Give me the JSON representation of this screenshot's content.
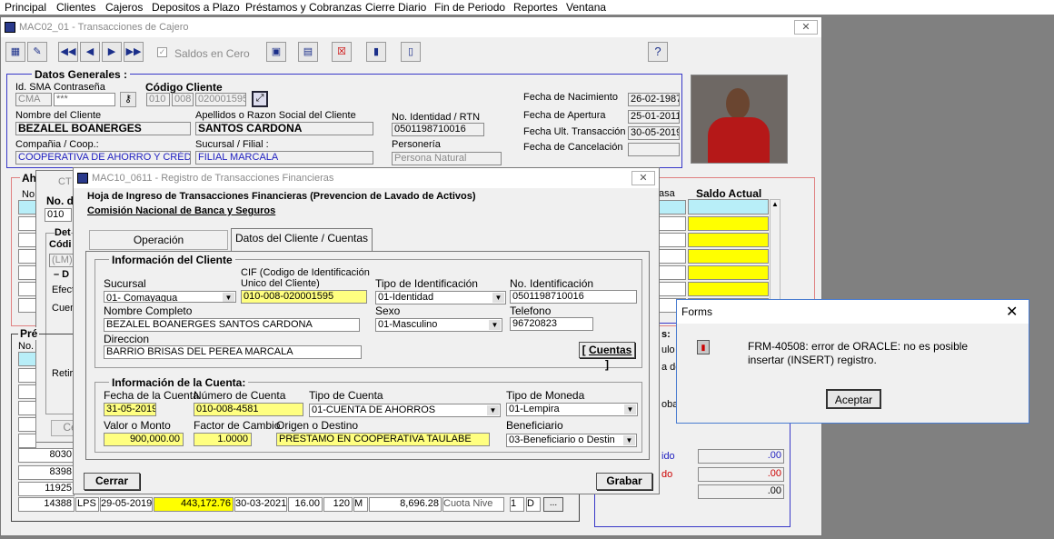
{
  "menu": [
    "Principal",
    "Clientes",
    "Cajeros",
    "Depositos a Plazo",
    "Préstamos y Cobranzas",
    "Cierre Diario",
    "Fin de Periodo",
    "Reportes",
    "Ventana"
  ],
  "main": {
    "title": "MAC02_01 - Transacciones de Cajero",
    "saldos_label": "Saldos en Cero",
    "help": "?"
  },
  "datos": {
    "section": "Datos Generales :",
    "id_sma_label": "Id. SMA",
    "contrasena_label": "Contraseña",
    "id_sma": "CMA",
    "contrasena": "***",
    "codigo_label": "Código Cliente",
    "codigo": [
      "010",
      "008",
      "020001595"
    ],
    "nombre_label": "Nombre del Cliente",
    "nombre": "BEZALEL BOANERGES",
    "apellidos_label": "Apellidos o Razon Social del Cliente",
    "apellidos": "SANTOS CARDONA",
    "identidad_label": "No. Identidad / RTN",
    "identidad": "0501198710016",
    "compania_label": "Compañia / Coop.:",
    "compania": "COOPERATIVA DE AHORRO Y CRÉDITO",
    "sucursal_label": "Sucursal / Filial :",
    "sucursal": "FILIAL MARCALA",
    "personeria_label": "Personería",
    "personeria": "Persona Natural",
    "nacimiento_label": "Fecha de Nacimiento",
    "nacimiento": "26-02-1987",
    "apertura_label": "Fecha de  Apertura",
    "apertura": "25-01-2011",
    "ult_label": "Fecha Ult. Transacción",
    "ult": "30-05-2019",
    "cancel_label": "Fecha de Cancelación",
    "cancel": ""
  },
  "bg": {
    "aho": "Aho",
    "no": "No",
    "ct": "CT",
    "nod": "No. d",
    "val010": "010",
    "det": "Det",
    "codi": "Códi",
    "lm": "(LM)",
    "d": "– D",
    "efec": "Efect",
    "cuen": "Cuen",
    "retir": "Retir",
    "ce": "Ce",
    "pre": "Pré",
    "no2": "No.",
    "nums": [
      "8030",
      "8398",
      "11925"
    ],
    "row": {
      "n": "14388",
      "mon": "LPS",
      "fecha": "29-05-2019",
      "monto": "443,172.76",
      "fecha2": "30-03-2021",
      "tasa": "16.00",
      "plazo": "120",
      "m": "M",
      "cuota": "8,696.28",
      "tipo": "Cuota Nive",
      "v1": "1",
      "d": "D",
      "more": "..."
    },
    "asa": "asa",
    "saldo_actual": "Saldo Actual",
    "s_label": "s:",
    "ulo": "ulo",
    "a_del": "a del",
    "obal": "obal",
    "ido": "ido",
    "do_lbl": "do",
    "v1": ".00",
    "v2": ".00",
    "v3": ".00"
  },
  "mac10": {
    "title": "MAC10_0611 - Registro de Transacciones Financieras",
    "header1": "Hoja de Ingreso de Transacciones Financieras (Prevencion de Lavado de Activos)",
    "header2": "Comisión Nacional de Banca y Seguros",
    "tab_operacion": "Operación",
    "tab_datos": "Datos del Cliente / Cuentas",
    "info_cliente": "Información del Cliente",
    "sucursal_label": "Sucursal",
    "sucursal": "01- Comayagua",
    "cif_label1": "CIF (Codigo de Identificación",
    "cif_label2": "Unico del Cliente)",
    "cif": "010-008-020001595",
    "tipo_id_label": "Tipo de Identificación",
    "tipo_id": "01-Identidad",
    "no_id_label": "No. Identificación",
    "no_id": "0501198710016",
    "nombre_label": "Nombre Completo",
    "nombre": "BEZALEL BOANERGES SANTOS CARDONA",
    "sexo_label": "Sexo",
    "sexo": "01-Masculino",
    "telefono_label": "Telefono",
    "telefono": "96720823",
    "direccion_label": "Direccion",
    "direccion": "BARRIO BRISAS DEL PEREA MARCALA",
    "cuentas_btn": "Cuentas",
    "info_cuenta": "Información de la Cuenta:",
    "fecha_label": "Fecha de la Cuenta",
    "fecha": "31-05-2019",
    "num_cuenta_label": "Número de Cuenta",
    "num_cuenta": "010-008-4581",
    "tipo_cuenta_label": "Tipo de Cuenta",
    "tipo_cuenta": "01-CUENTA DE AHORROS",
    "moneda_label": "Tipo de Moneda",
    "moneda": "01-Lempira",
    "valor_label": "Valor o Monto",
    "valor": "900,000.00",
    "factor_label": "Factor de Cambio",
    "factor": "1.0000",
    "origen_label": "Origen o Destino",
    "origen": "PRESTAMO EN COOPERATIVA TAULABE",
    "beneficiario_label": "Beneficiario",
    "beneficiario": "03-Beneficiario o Destin",
    "cerrar": "Cerrar",
    "grabar": "Grabar"
  },
  "forms": {
    "title": "Forms",
    "message": "FRM-40508: error de ORACLE: no es posible insertar (INSERT) registro.",
    "ok": "Aceptar"
  },
  "colors": {
    "yellow": "#ffff80",
    "cyan": "#b8eef8",
    "accent": "#3838c8"
  }
}
